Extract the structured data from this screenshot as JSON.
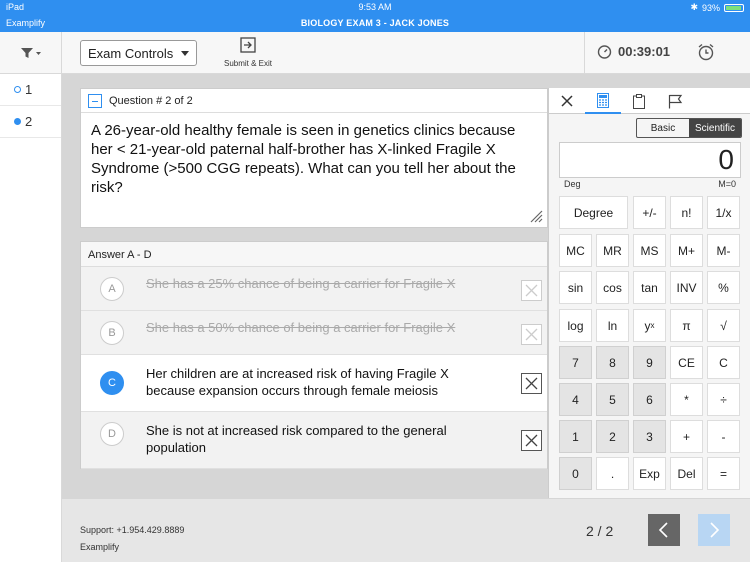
{
  "status_bar": {
    "device": "iPad",
    "time": "9:53 AM",
    "battery": "93%",
    "battery_level": 0.93
  },
  "title_bar": {
    "app_name": "Examplify",
    "exam_title": "BIOLOGY EXAM 3 - JACK JONES"
  },
  "toolbar": {
    "exam_controls_label": "Exam Controls",
    "submit_exit_label": "Submit & Exit",
    "timer": "00:39:01"
  },
  "sidebar": {
    "questions": [
      {
        "number": "1",
        "answered": false
      },
      {
        "number": "2",
        "answered": true
      }
    ]
  },
  "question": {
    "header": "Question # 2 of 2",
    "text": "A 26-year-old healthy female is seen in genetics clinics because her < 21-year-old paternal half-brother has X-linked Fragile X Syndrome (>500 CGG repeats).  What can you tell her about the risk?"
  },
  "answers": {
    "header": "Answer A - D",
    "options": [
      {
        "letter": "A",
        "text": "She has a 25% chance of being a carrier for Fragile X",
        "crossed_out": true
      },
      {
        "letter": "B",
        "text": "She has a 50% chance of being a carrier for Fragile X",
        "crossed_out": true
      },
      {
        "letter": "C",
        "text": "Her children are at increased risk of having Fragile X because expansion occurs through female meiosis",
        "selected": true
      },
      {
        "letter": "D",
        "text": "She is not at increased risk compared to the general population"
      }
    ]
  },
  "calculator": {
    "mode_basic": "Basic",
    "mode_scientific": "Scientific",
    "display": "0",
    "angle_unit": "Deg",
    "memory": "M=0",
    "keys": {
      "degree": "Degree",
      "plus_minus": "+/-",
      "factorial": "n!",
      "reciprocal": "1/x",
      "mc": "MC",
      "mr": "MR",
      "ms": "MS",
      "m_plus": "M+",
      "m_minus": "M-",
      "sin": "sin",
      "cos": "cos",
      "tan": "tan",
      "inv": "INV",
      "percent": "%",
      "log": "log",
      "ln": "ln",
      "y_pow_x_base": "y",
      "y_pow_x_exp": "x",
      "pi": "π",
      "sqrt": "√",
      "d7": "7",
      "d8": "8",
      "d9": "9",
      "ce": "CE",
      "c": "C",
      "d4": "4",
      "d5": "5",
      "d6": "6",
      "multiply": "*",
      "divide": "÷",
      "d1": "1",
      "d2": "2",
      "d3": "3",
      "plus": "+",
      "minus": "-",
      "d0": "0",
      "dot": ".",
      "exp": "Exp",
      "del": "Del",
      "equals": "="
    }
  },
  "footer": {
    "support": "Support: +1.954.429.8889",
    "app_name": "Examplify",
    "pager": "2 / 2"
  },
  "colors": {
    "accent": "#2f8ff0",
    "prev_button": "#666666",
    "next_button_disabled": "#b8d6f3"
  }
}
